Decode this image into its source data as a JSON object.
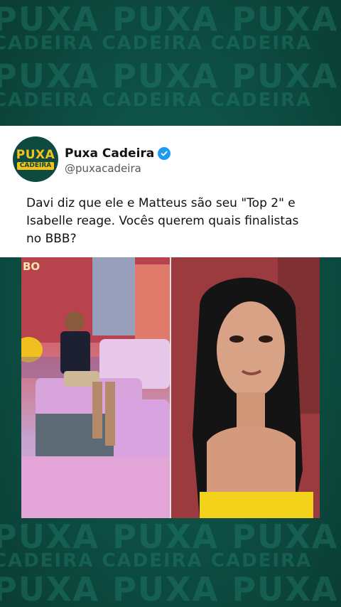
{
  "watermark": {
    "brand": "PUXA",
    "sub": "CADEIRA"
  },
  "post": {
    "account_name": "Puxa Cadeira",
    "handle": "@puxacadeira",
    "verified": true,
    "avatar_top": "PUXA",
    "avatar_bottom": "CADEIRA",
    "text": "Davi diz que ele e Matteus são seu \"Top 2\" e Isabelle reage. Vocês querem quais finalistas no BBB?"
  },
  "photo": {
    "corner_badge": "BO",
    "left_description_icon": "bedroom-scene",
    "right_description_icon": "woman-portrait"
  },
  "colors": {
    "brand_green": "#0e4a3f",
    "brand_yellow": "#f2c21b",
    "verified_blue": "#1d9bf0"
  }
}
